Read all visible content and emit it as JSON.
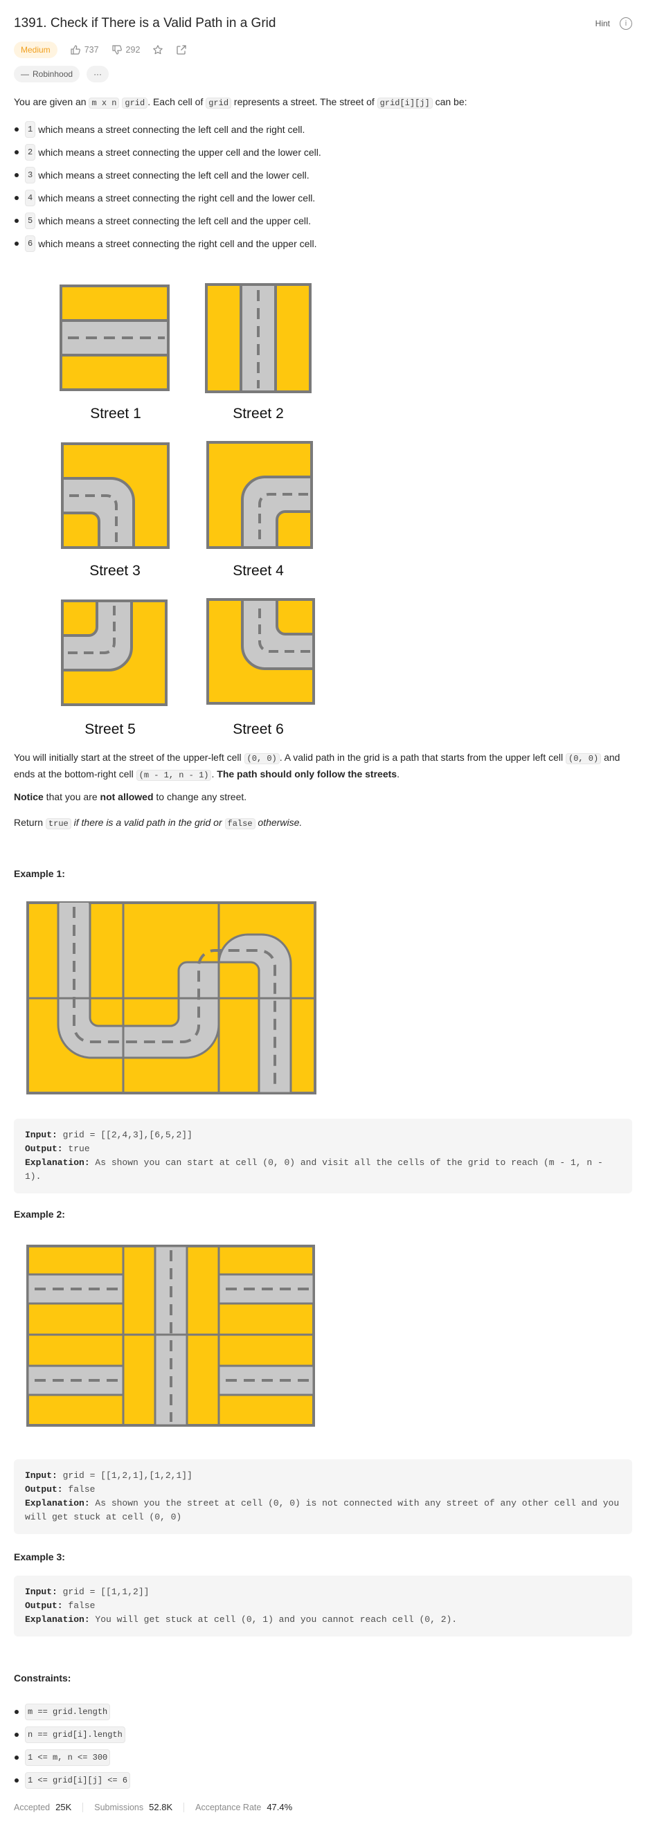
{
  "header": {
    "title": "1391. Check if There is a Valid Path in a Grid",
    "hint_label": "Hint",
    "info_icon": "info-icon"
  },
  "meta": {
    "difficulty": "Medium",
    "likes": "737",
    "dislikes": "292"
  },
  "tags": {
    "company": "Robinhood",
    "more": "···"
  },
  "description": {
    "intro_1": "You are given an ",
    "intro_code_1": "m x n",
    "intro_2": " ",
    "intro_code_2": "grid",
    "intro_3": ". Each cell of ",
    "intro_code_3": "grid",
    "intro_4": " represents a street. The street of ",
    "intro_code_4": "grid[i][j]",
    "intro_5": " can be:",
    "streets": [
      {
        "code": "1",
        "text": "which means a street connecting the left cell and the right cell."
      },
      {
        "code": "2",
        "text": "which means a street connecting the upper cell and the lower cell."
      },
      {
        "code": "3",
        "text": "which means a street connecting the left cell and the lower cell."
      },
      {
        "code": "4",
        "text": "which means a street connecting the right cell and the lower cell."
      },
      {
        "code": "5",
        "text": "which means a street connecting the left cell and the upper cell."
      },
      {
        "code": "6",
        "text": "which means a street connecting the right cell and the upper cell."
      }
    ],
    "street_labels": [
      "Street 1",
      "Street 2",
      "Street 3",
      "Street 4",
      "Street 5",
      "Street 6"
    ],
    "p1_a": "You will initially start at the street of the upper-left cell ",
    "p1_code_1": "(0, 0)",
    "p1_b": ". A valid path in the grid is a path that starts from the upper left cell ",
    "p1_code_2": "(0, 0)",
    "p1_c": " and ends at the bottom-right cell ",
    "p1_code_3": "(m - 1, n - 1)",
    "p1_d": ". ",
    "p1_bold": "The path should only follow the streets",
    "p1_e": ".",
    "p2_bold_1": "Notice",
    "p2_a": " that you are ",
    "p2_bold_2": "not allowed",
    "p2_b": " to change any street.",
    "p3_a": "Return ",
    "p3_code_1": "true",
    "p3_ital": " if there is a valid path in the grid or ",
    "p3_code_2": "false",
    "p3_b": " otherwise."
  },
  "examples": [
    {
      "heading": "Example 1:",
      "input_label": "Input:",
      "input": " grid = [[2,4,3],[6,5,2]]",
      "output_label": "Output:",
      "output": " true",
      "expl_label": "Explanation:",
      "expl": " As shown you can start at cell (0, 0) and visit all the cells of the grid to reach (m - 1, n - 1)."
    },
    {
      "heading": "Example 2:",
      "input_label": "Input:",
      "input": " grid = [[1,2,1],[1,2,1]]",
      "output_label": "Output:",
      "output": " false",
      "expl_label": "Explanation:",
      "expl": " As shown you the street at cell (0, 0) is not connected with any street of any other cell and you will get stuck at cell (0, 0)"
    },
    {
      "heading": "Example 3:",
      "input_label": "Input:",
      "input": " grid = [[1,1,2]]",
      "output_label": "Output:",
      "output": " false",
      "expl_label": "Explanation:",
      "expl": " You will get stuck at cell (0, 1) and you cannot reach cell (0, 2)."
    }
  ],
  "constraints": {
    "heading": "Constraints:",
    "items": [
      "m == grid.length",
      "n == grid[i].length",
      "1 <= m, n <= 300",
      "1 <= grid[i][j] <= 6"
    ]
  },
  "stats": {
    "accepted_label": "Accepted",
    "accepted": "25K",
    "submissions_label": "Submissions",
    "submissions": "52.8K",
    "rate_label": "Acceptance Rate",
    "rate": "47.4%"
  },
  "colors": {
    "street_yellow": "#fec70e",
    "road_gray": "#c8c8c8",
    "border_gray": "#7a7a7a",
    "medium_orange": "#f0a020"
  }
}
